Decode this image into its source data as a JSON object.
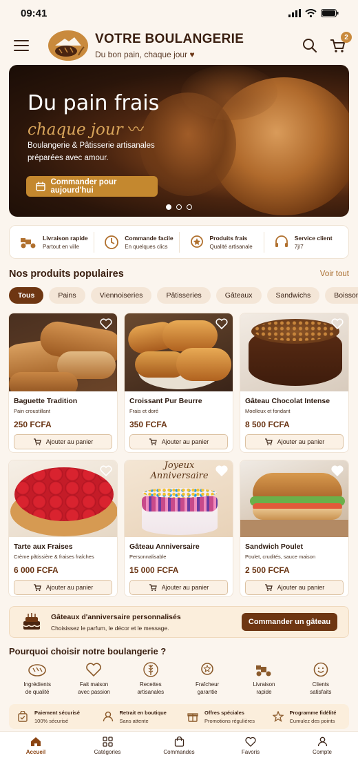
{
  "status": {
    "time": "09:41"
  },
  "brand": {
    "title": "VOTRE BOULANGERIE",
    "subtitle": "Du bon pain, chaque jour"
  },
  "cart": {
    "count": "2"
  },
  "hero": {
    "title": "Du pain frais",
    "script": "chaque jour",
    "description": "Boulangerie & Pâtisserie artisanales préparées avec amour.",
    "cta": "Commander pour aujourd'hui"
  },
  "features": [
    {
      "title": "Livraison rapide",
      "sub": "Partout en ville"
    },
    {
      "title": "Commande facile",
      "sub": "En quelques clics"
    },
    {
      "title": "Produits frais",
      "sub": "Qualité artisanale"
    },
    {
      "title": "Service client",
      "sub": "7j/7"
    }
  ],
  "products_section": {
    "title": "Nos produits populaires",
    "see_all": "Voir tout"
  },
  "categories": [
    "Tous",
    "Pains",
    "Viennoiseries",
    "Pâtisseries",
    "Gâteaux",
    "Sandwichs",
    "Boissons"
  ],
  "products": [
    {
      "name": "Baguette Tradition",
      "desc": "Pain croustillant",
      "price": "250 FCFA"
    },
    {
      "name": "Croissant Pur Beurre",
      "desc": "Frais et doré",
      "price": "350 FCFA"
    },
    {
      "name": "Gâteau Chocolat Intense",
      "desc": "Moelleux et fondant",
      "price": "8 500 FCFA"
    },
    {
      "name": "Tarte aux Fraises",
      "desc": "Crème pâtissière & fraises fraîches",
      "price": "6 000 FCFA"
    },
    {
      "name": "Gâteau Anniversaire",
      "desc": "Personnalisable",
      "price": "15 000 FCFA",
      "cake_text_1": "Joyeux",
      "cake_text_2": "Anniversaire"
    },
    {
      "name": "Sandwich Poulet",
      "desc": "Poulet, crudités, sauce maison",
      "price": "2 500 FCFA"
    }
  ],
  "add_to_cart": "Ajouter au panier",
  "promo": {
    "title": "Gâteaux d'anniversaire personnalisés",
    "sub": "Choisissez le parfum, le décor et le message.",
    "button": "Commander un gâteau"
  },
  "why": {
    "title": "Pourquoi choisir notre boulangerie ?",
    "items": [
      {
        "l1": "Ingrédients",
        "l2": "de qualité"
      },
      {
        "l1": "Fait maison",
        "l2": "avec passion"
      },
      {
        "l1": "Recettes",
        "l2": "artisanales"
      },
      {
        "l1": "Fraîcheur",
        "l2": "garantie"
      },
      {
        "l1": "Livraison",
        "l2": "rapide"
      },
      {
        "l1": "Clients",
        "l2": "satisfaits"
      }
    ]
  },
  "trust": [
    {
      "title": "Paiement sécurisé",
      "sub": "100% sécurisé"
    },
    {
      "title": "Retrait en boutique",
      "sub": "Sans attente"
    },
    {
      "title": "Offres spéciales",
      "sub": "Promotions régulières"
    },
    {
      "title": "Programme fidélité",
      "sub": "Cumulez des points"
    }
  ],
  "tabs": [
    "Accueil",
    "Catégories",
    "Commandes",
    "Favoris",
    "Compte"
  ],
  "colors": {
    "primary": "#6e3612",
    "accent": "#c4882f",
    "background": "#fbf5ee"
  }
}
